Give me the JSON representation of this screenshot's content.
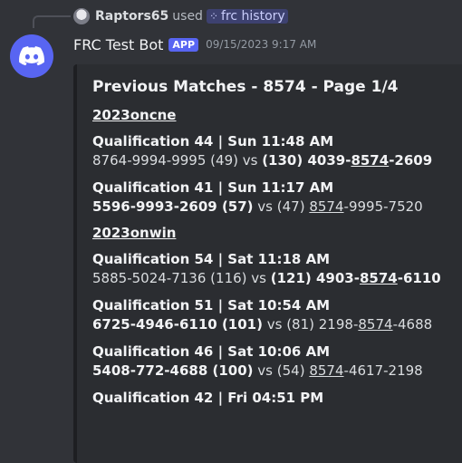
{
  "reply": {
    "username": "Raptors65",
    "used": "used",
    "command": "frc history"
  },
  "message": {
    "author": "FRC Test Bot",
    "badge": "APP",
    "timestamp": "09/15/2023 9:17 AM"
  },
  "embed": {
    "title": "Previous Matches - 8574 - Page 1/4",
    "events": [
      {
        "name": "2023oncne",
        "matches": [
          {
            "heading": "Qualification 44 | Sun 11:48 AM",
            "red": [
              "8764",
              "9994",
              "9995"
            ],
            "red_score": "49",
            "blue": [
              "4039",
              "8574",
              "2609"
            ],
            "blue_score": "130",
            "winner": "blue"
          },
          {
            "heading": "Qualification 41 | Sun 11:17 AM",
            "red": [
              "5596",
              "9993",
              "2609"
            ],
            "red_score": "57",
            "blue": [
              "8574",
              "9995",
              "7520"
            ],
            "blue_score": "47",
            "winner": "red"
          }
        ]
      },
      {
        "name": "2023onwin",
        "matches": [
          {
            "heading": "Qualification 54 | Sat 11:18 AM",
            "red": [
              "5885",
              "5024",
              "7136"
            ],
            "red_score": "116",
            "blue": [
              "4903",
              "8574",
              "6110"
            ],
            "blue_score": "121",
            "winner": "blue"
          },
          {
            "heading": "Qualification 51 | Sat 10:54 AM",
            "red": [
              "6725",
              "4946",
              "6110"
            ],
            "red_score": "101",
            "blue": [
              "2198",
              "8574",
              "4688"
            ],
            "blue_score": "81",
            "winner": "red"
          },
          {
            "heading": "Qualification 46 | Sat 10:06 AM",
            "red": [
              "5408",
              "772",
              "4688"
            ],
            "red_score": "100",
            "blue": [
              "8574",
              "4617",
              "2198"
            ],
            "blue_score": "54",
            "winner": "red"
          },
          {
            "heading": "Qualification 42 | Fri 04:51 PM",
            "red": [],
            "red_score": "",
            "blue": [],
            "blue_score": "",
            "winner": ""
          }
        ]
      }
    ],
    "highlight_team": "8574",
    "vs": "vs"
  },
  "colors": {
    "background": "#313338",
    "embed": "#2b2d31",
    "brand": "#5865f2"
  }
}
